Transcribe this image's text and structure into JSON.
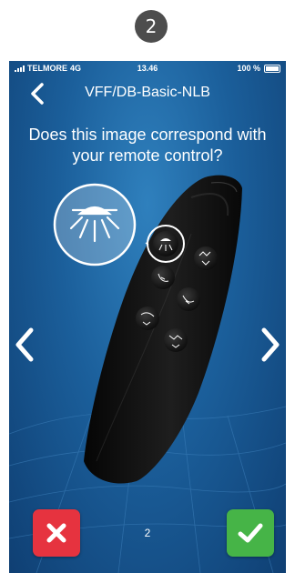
{
  "step": {
    "number": "2"
  },
  "status_bar": {
    "carrier": "TELMORE",
    "network": "4G",
    "time": "13.46",
    "battery": "100 %"
  },
  "nav": {
    "title": "VFF/DB-Basic-NLB",
    "back_icon": "chevron-left-icon"
  },
  "question": "Does this image correspond with your remote control?",
  "carousel": {
    "prev_icon": "chevron-left-icon",
    "next_icon": "chevron-right-icon",
    "page": "2"
  },
  "actions": {
    "reject_icon": "close-icon",
    "accept_icon": "checkmark-icon"
  },
  "colors": {
    "background": "#1b5f9b",
    "reject": "#e6333f",
    "accept": "#46b447",
    "step_badge": "#4d4d4d"
  }
}
